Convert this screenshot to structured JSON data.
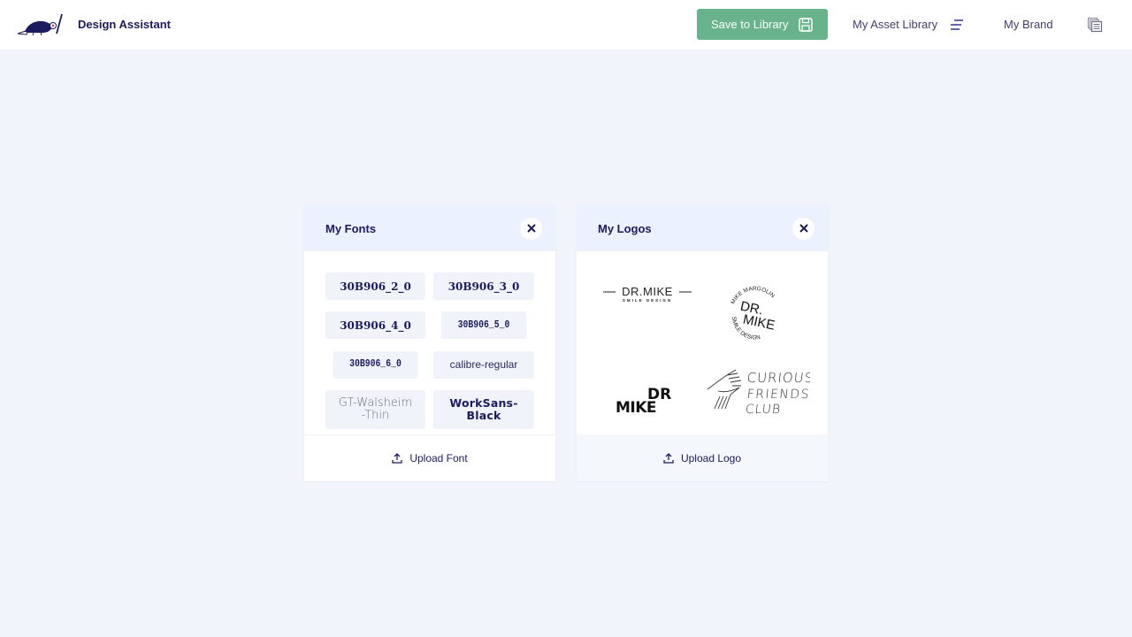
{
  "header": {
    "app_title": "Design Assistant",
    "logo_icon": "armadillo-pencil-logo",
    "buttons": [
      {
        "label": "Save to Library",
        "icon": "floppy-disk-icon"
      },
      {
        "label": "My Asset Library",
        "icon": "lines-menu-icon"
      },
      {
        "label": "My Brand",
        "icon": "stacked-documents-icon"
      }
    ],
    "colors": {
      "save_button": "#68b38c",
      "text_primary": "#1b1b5e",
      "background": "#f1f5fb"
    }
  },
  "fonts_panel": {
    "title": "My Fonts",
    "close_icon": "close-icon",
    "fonts": [
      {
        "name": "30B906_2_0"
      },
      {
        "name": "30B906_3_0"
      },
      {
        "name": "30B906_4_0"
      },
      {
        "name": "30B906_5_0"
      },
      {
        "name": "30B906_6_0"
      },
      {
        "name": "calibre-regular"
      },
      {
        "name": "GT-Walsheim-Thin"
      },
      {
        "name": "WorkSans-Black"
      }
    ],
    "upload_label": "Upload Font",
    "upload_icon": "upload-icon"
  },
  "logos_panel": {
    "title": "My Logos",
    "close_icon": "close-icon",
    "logos": [
      {
        "name": "dr-mike-smile-design-horizontal",
        "main": "DR.MIKE",
        "sub": "SMILE DESIGN"
      },
      {
        "name": "dr-mike-circular",
        "main1": "DR.",
        "main2": "MIKE",
        "ring_top": "MIKE MARGOLIN",
        "ring_bottom": "SMILE DESIGN"
      },
      {
        "name": "dr-mike-stacked",
        "line1": "DR",
        "line2": "MIKE"
      },
      {
        "name": "curious-friends-club",
        "line1": "CURIOUS",
        "line2": "FRIENDS",
        "line3": "CLUB"
      }
    ],
    "upload_label": "Upload Logo",
    "upload_icon": "upload-icon"
  }
}
